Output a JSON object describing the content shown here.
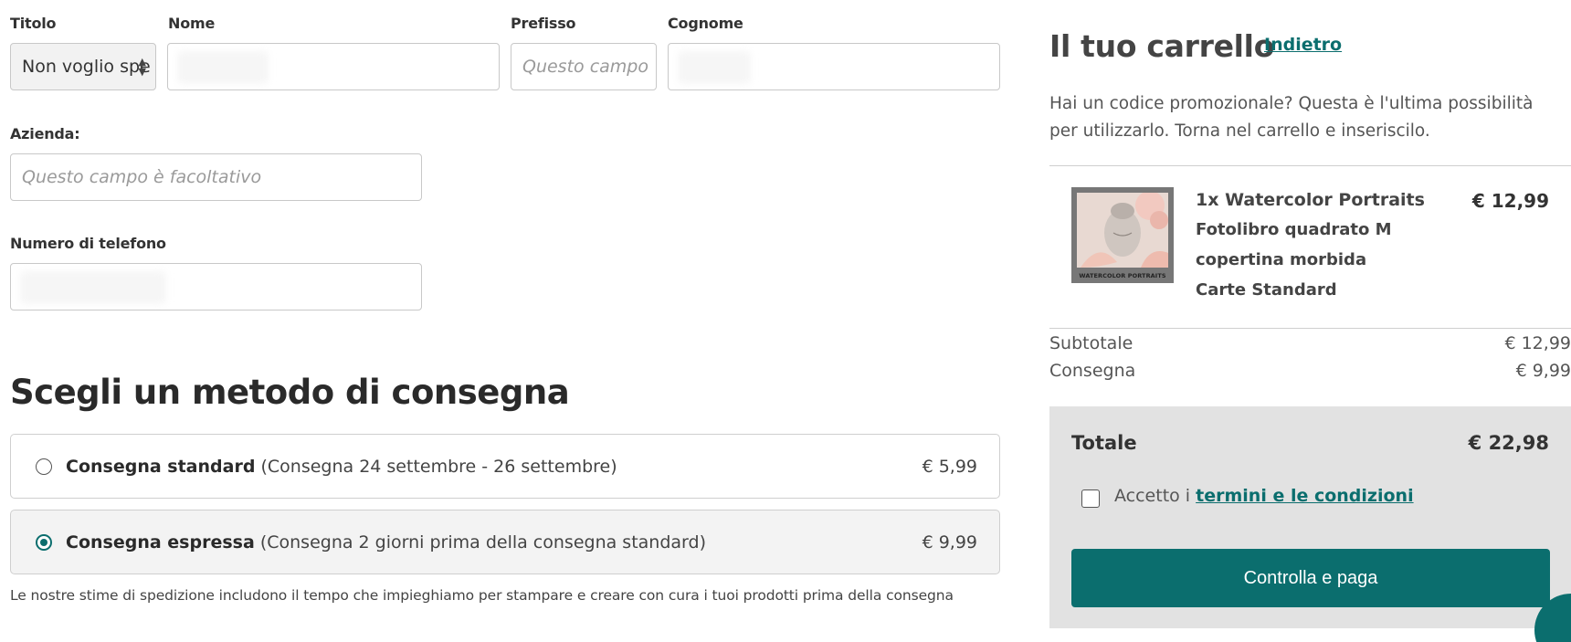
{
  "form": {
    "title_label": "Titolo",
    "title_value": "Non voglio spe",
    "name_label": "Nome",
    "name_value": "",
    "prefix_label": "Prefisso",
    "prefix_placeholder": "Questo campo",
    "surname_label": "Cognome",
    "surname_value": "",
    "company_label": "Azienda:",
    "company_placeholder": "Questo campo è facoltativo",
    "phone_label": "Numero di telefono",
    "phone_value": ""
  },
  "delivery": {
    "heading": "Scegli un metodo di consegna",
    "options": [
      {
        "name": "Consegna standard",
        "detail": "(Consegna 24 settembre - 26 settembre)",
        "price": "€ 5,99",
        "selected": false
      },
      {
        "name": "Consegna espressa",
        "detail": "(Consegna 2 giorni prima della consegna standard)",
        "price": "€ 9,99",
        "selected": true
      }
    ],
    "note": "Le nostre stime di spedizione includono il tempo che impieghiamo per stampare e creare con cura i tuoi prodotti prima della consegna"
  },
  "cart": {
    "title": "Il tuo carrello",
    "back_link": "Indietro",
    "promo_text": "Hai un codice promozionale? Questa è l'ultima possibilità per utilizzarlo. Torna nel carrello e inseriscilo.",
    "item": {
      "name": "1x Watercolor Portraits",
      "line2": "Fotolibro quadrato M",
      "line3": "copertina morbida",
      "line4": "Carte Standard",
      "price": "€ 12,99",
      "thumb_caption": "WATERCOLOR PORTRAITS"
    },
    "subtotal_label": "Subtotale",
    "subtotal_value": "€ 12,99",
    "shipping_label": "Consegna",
    "shipping_value": "€ 9,99",
    "total_label": "Totale",
    "total_value": "€ 22,98",
    "accept_prefix": "Accetto i",
    "terms_link": "termini e le condizioni",
    "pay_button": "Controlla e paga"
  },
  "colors": {
    "accent": "#0b6e6e",
    "total_bg": "#e2e2e2"
  }
}
